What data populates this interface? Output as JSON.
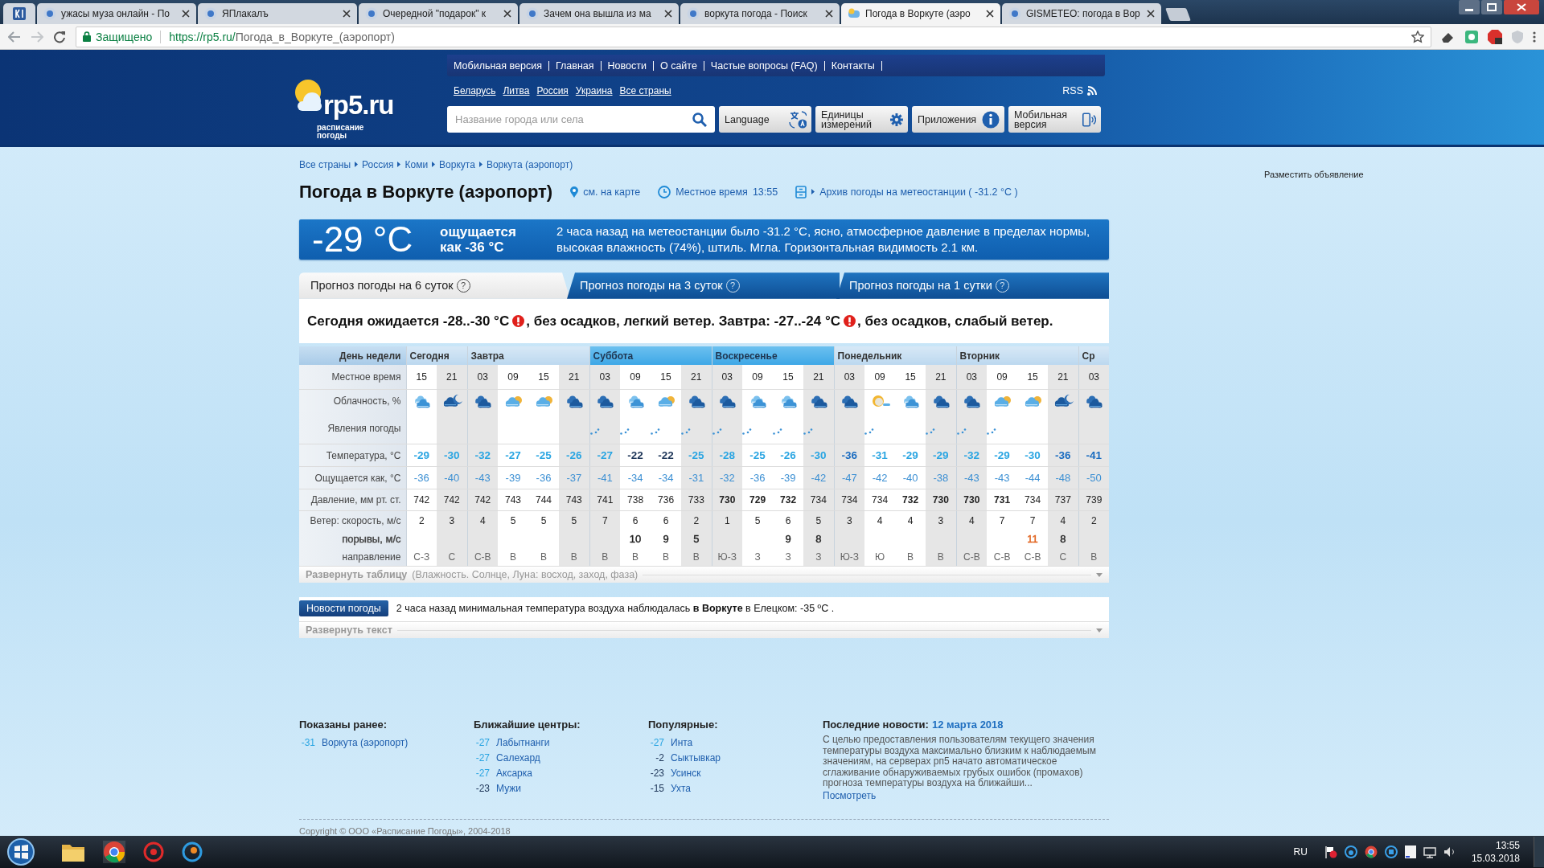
{
  "browser": {
    "tabs": [
      {
        "kind": "pinned",
        "selected": false
      },
      {
        "kind": "page",
        "title": "ужасы муза онлайн - По",
        "selected": false
      },
      {
        "kind": "page",
        "title": "ЯПлакалъ",
        "selected": false
      },
      {
        "kind": "page",
        "title": "Очередной \"подарок\" к",
        "selected": false
      },
      {
        "kind": "page",
        "title": "Зачем она вышла из ма",
        "selected": false
      },
      {
        "kind": "page",
        "title": "воркута погода - Поиск",
        "selected": false
      },
      {
        "kind": "page",
        "title": "Погода в Воркуте (аэро",
        "selected": true
      },
      {
        "kind": "page",
        "title": "GISMETEO: погода в Вор",
        "selected": false
      }
    ],
    "secure": "Защищено",
    "url_host": "https://rp5.ru/",
    "url_path": "Погода_в_Воркуте_(аэропорт)"
  },
  "site": {
    "nav": [
      "Мобильная версия",
      "Главная",
      "Новости",
      "О сайте",
      "Частые вопросы (FAQ)",
      "Контакты"
    ],
    "logo": "rp5.ru",
    "tagline": "расписание погоды",
    "countries": [
      "Беларусь",
      "Литва",
      "Россия",
      "Украина",
      "Все страны"
    ],
    "rss": "RSS",
    "search": {
      "placeholder": "Название города или села"
    },
    "tools": [
      {
        "label": "Language",
        "kind": "translate"
      },
      {
        "label": "Единицы измерений",
        "kind": "gear"
      },
      {
        "label": "Приложения",
        "kind": "info"
      },
      {
        "label": "Мобильная версия",
        "kind": "phone"
      }
    ]
  },
  "breadcrumbs": [
    "Все страны",
    "Россия",
    "Коми",
    "Воркута",
    "Воркута (аэропорт)"
  ],
  "title": "Погода в Воркуте (аэропорт)",
  "map_link": "см. на карте",
  "local_time_label": "Местное время",
  "local_time": "13:55",
  "archive": "Архив погоды на метеостанции ( -31.2 °C )",
  "ad": "Разместить объявление",
  "current": {
    "temp": "-29 °C",
    "feels_label": "ощущается",
    "feels": "как -36 °C",
    "description": "2 часа назад на метеостанции было -31.2 °C, ясно, атмосферное давление в пределах нормы, высокая влажность (74%), штиль. Мгла. Горизонтальная видимость 2.1 км."
  },
  "forecast_tabs": [
    {
      "label": "Прогноз погоды на 6 суток",
      "help": "?",
      "selected": true
    },
    {
      "label": "Прогноз погоды на 3 суток",
      "help": "?",
      "selected": false
    },
    {
      "label": "Прогноз погоды на 1 сутки",
      "help": "?",
      "selected": false
    }
  ],
  "summary": [
    {
      "text": "Сегодня ожидается -28..-30 °C",
      "warning": true
    },
    {
      "text": ", без осадков, легкий ветер. Завтра: -27..-24 °C",
      "warning": true
    },
    {
      "text": ", без осадков, слабый ветер.",
      "warning": false
    }
  ],
  "table": {
    "row_labels": [
      "День недели",
      "Местное время",
      "Облачность, %",
      "Явления погоды",
      "Температура, °C",
      "Ощущается как, °C",
      "Давление, мм рт. ст.",
      "Ветер: скорость, м/с",
      "порывы, м/с",
      "направление"
    ],
    "days": [
      {
        "label": "Сегодня",
        "weekend": false,
        "slots": [
          {
            "time": "15",
            "night": false,
            "kind": "overcast",
            "snow": false,
            "temp": "-29",
            "color": "#2aa5e2",
            "feels": "-36",
            "pressure": "742",
            "pressure_bold": false,
            "wind": "2",
            "dir": "С-З"
          },
          {
            "time": "21",
            "night": true,
            "kind": "partly-night",
            "snow": false,
            "temp": "-30",
            "color": "#2aa5e2",
            "feels": "-40",
            "pressure": "742",
            "pressure_bold": false,
            "wind": "3",
            "dir": "С"
          }
        ]
      },
      {
        "label": "Завтра",
        "weekend": false,
        "slots": [
          {
            "time": "03",
            "night": true,
            "kind": "overcast-night",
            "snow": false,
            "temp": "-32",
            "color": "#2aa5e2",
            "feels": "-43",
            "pressure": "742",
            "pressure_bold": false,
            "wind": "4",
            "dir": "С-В"
          },
          {
            "time": "09",
            "night": false,
            "kind": "partly",
            "snow": false,
            "temp": "-27",
            "color": "#2aa5e2",
            "feels": "-39",
            "pressure": "743",
            "pressure_bold": false,
            "wind": "5",
            "dir": "В"
          },
          {
            "time": "15",
            "night": false,
            "kind": "partly",
            "snow": false,
            "temp": "-25",
            "color": "#2aa5e2",
            "feels": "-36",
            "pressure": "744",
            "pressure_bold": false,
            "wind": "5",
            "dir": "В"
          },
          {
            "time": "21",
            "night": true,
            "kind": "overcast-night",
            "snow": false,
            "temp": "-26",
            "color": "#2aa5e2",
            "feels": "-37",
            "pressure": "743",
            "pressure_bold": false,
            "wind": "5",
            "dir": "В"
          }
        ]
      },
      {
        "label": "Суббота",
        "weekend": true,
        "slots": [
          {
            "time": "03",
            "night": true,
            "kind": "overcast-night",
            "snow": true,
            "temp": "-27",
            "color": "#2aa5e2",
            "feels": "-41",
            "pressure": "741",
            "pressure_bold": false,
            "wind": "7",
            "dir": "В"
          },
          {
            "time": "09",
            "night": false,
            "kind": "overcast",
            "snow": true,
            "temp": "-22",
            "color": "#1d3558",
            "feels": "-34",
            "pressure": "738",
            "pressure_bold": false,
            "wind": "6",
            "gust": {
              "value": "10",
              "color": "#222222"
            },
            "dir": "В"
          },
          {
            "time": "15",
            "night": false,
            "kind": "partly",
            "snow": true,
            "temp": "-22",
            "color": "#1d3558",
            "feels": "-34",
            "pressure": "736",
            "pressure_bold": false,
            "wind": "6",
            "gust": {
              "value": "9",
              "color": "#222222"
            },
            "dir": "В"
          },
          {
            "time": "21",
            "night": true,
            "kind": "overcast-night",
            "snow": true,
            "temp": "-25",
            "color": "#2aa5e2",
            "feels": "-31",
            "pressure": "733",
            "pressure_bold": false,
            "wind": "2",
            "gust": {
              "value": "5",
              "color": "#222222"
            },
            "dir": "В"
          }
        ]
      },
      {
        "label": "Воскресенье",
        "weekend": true,
        "slots": [
          {
            "time": "03",
            "night": true,
            "kind": "overcast-night",
            "snow": true,
            "temp": "-28",
            "color": "#2aa5e2",
            "feels": "-32",
            "pressure": "730",
            "pressure_bold": true,
            "wind": "1",
            "dir": "Ю-З"
          },
          {
            "time": "09",
            "night": false,
            "kind": "overcast",
            "snow": true,
            "temp": "-25",
            "color": "#2aa5e2",
            "feels": "-36",
            "pressure": "729",
            "pressure_bold": true,
            "wind": "5",
            "dir": "З"
          },
          {
            "time": "15",
            "night": false,
            "kind": "overcast",
            "snow": true,
            "temp": "-26",
            "color": "#2aa5e2",
            "feels": "-39",
            "pressure": "732",
            "pressure_bold": true,
            "wind": "6",
            "gust": {
              "value": "9",
              "color": "#222222"
            },
            "dir": "З"
          },
          {
            "time": "21",
            "night": true,
            "kind": "overcast-night",
            "snow": true,
            "temp": "-30",
            "color": "#2aa5e2",
            "feels": "-42",
            "pressure": "734",
            "pressure_bold": false,
            "wind": "5",
            "gust": {
              "value": "8",
              "color": "#222222"
            },
            "dir": "З"
          }
        ]
      },
      {
        "label": "Понедельник",
        "weekend": false,
        "slots": [
          {
            "time": "03",
            "night": true,
            "kind": "overcast-night",
            "snow": false,
            "temp": "-36",
            "color": "#1a6cc0",
            "feels": "-47",
            "pressure": "734",
            "pressure_bold": false,
            "wind": "3",
            "dir": "Ю-З"
          },
          {
            "time": "09",
            "night": false,
            "kind": "clear",
            "snow": true,
            "temp": "-31",
            "color": "#2aa5e2",
            "feels": "-42",
            "pressure": "734",
            "pressure_bold": false,
            "wind": "4",
            "dir": "Ю"
          },
          {
            "time": "15",
            "night": false,
            "kind": "overcast",
            "snow": false,
            "temp": "-29",
            "color": "#2aa5e2",
            "feels": "-40",
            "pressure": "732",
            "pressure_bold": true,
            "wind": "4",
            "dir": "В"
          },
          {
            "time": "21",
            "night": true,
            "kind": "overcast-night",
            "snow": true,
            "temp": "-29",
            "color": "#2aa5e2",
            "feels": "-38",
            "pressure": "730",
            "pressure_bold": true,
            "wind": "3",
            "dir": "В"
          }
        ]
      },
      {
        "label": "Вторник",
        "weekend": false,
        "slots": [
          {
            "time": "03",
            "night": true,
            "kind": "overcast-night",
            "snow": true,
            "temp": "-32",
            "color": "#2aa5e2",
            "feels": "-43",
            "pressure": "730",
            "pressure_bold": true,
            "wind": "4",
            "dir": "С-В"
          },
          {
            "time": "09",
            "night": false,
            "kind": "partly",
            "snow": true,
            "temp": "-29",
            "color": "#2aa5e2",
            "feels": "-43",
            "pressure": "731",
            "pressure_bold": true,
            "wind": "7",
            "dir": "С-В"
          },
          {
            "time": "15",
            "night": false,
            "kind": "partly",
            "snow": false,
            "temp": "-30",
            "color": "#2aa5e2",
            "feels": "-44",
            "pressure": "734",
            "pressure_bold": false,
            "wind": "7",
            "gust": {
              "value": "11",
              "color": "#e0611b"
            },
            "dir": "С-В"
          },
          {
            "time": "21",
            "night": true,
            "kind": "partly-night",
            "snow": false,
            "temp": "-36",
            "color": "#1a6cc0",
            "feels": "-48",
            "pressure": "737",
            "pressure_bold": false,
            "wind": "4",
            "gust": {
              "value": "8",
              "color": "#222222"
            },
            "dir": "С"
          }
        ]
      },
      {
        "label": "Ср",
        "weekend": false,
        "slots": [
          {
            "time": "03",
            "night": true,
            "kind": "overcast-night",
            "snow": false,
            "temp": "-41",
            "color": "#1a6cc0",
            "feels": "-50",
            "pressure": "739",
            "pressure_bold": false,
            "wind": "2",
            "dir": "В"
          }
        ]
      }
    ],
    "expand": "Развернуть таблицу",
    "expand_hint": "(Влажность. Солнце, Луна: восход, заход, фаза)"
  },
  "news": {
    "badge": "Новости погоды",
    "text": "2 часа назад минимальная температура воздуха наблюдалась **в Воркуте** в Елецком: -35 ºC .",
    "expand": "Развернуть текст"
  },
  "footer": {
    "lists": [
      {
        "title": "Показаны ранее:",
        "items": [
          {
            "temp": "-31",
            "color": "#2aa5e2",
            "name": "Воркута (аэропорт)"
          }
        ]
      },
      {
        "title": "Ближайшие центры:",
        "items": [
          {
            "temp": "-27",
            "color": "#2aa5e2",
            "name": "Лабытнанги"
          },
          {
            "temp": "-27",
            "color": "#2aa5e2",
            "name": "Салехард"
          },
          {
            "temp": "-27",
            "color": "#2aa5e2",
            "name": "Аксарка"
          },
          {
            "temp": "-23",
            "color": "#1d3558",
            "name": "Мужи"
          }
        ]
      },
      {
        "title": "Популярные:",
        "items": [
          {
            "temp": "-27",
            "color": "#2aa5e2",
            "name": "Инта"
          },
          {
            "temp": "-2",
            "color": "#1d3558",
            "name": "Сыктывкар"
          },
          {
            "temp": "-23",
            "color": "#1d3558",
            "name": "Усинск"
          },
          {
            "temp": "-15",
            "color": "#1d3558",
            "name": "Ухта"
          }
        ]
      }
    ],
    "news": {
      "title": "Последние новости:",
      "date": "12 марта 2018",
      "text": "С целью предоставления пользователям текущего значения температуры воздуха максимально близким к наблюдаемым значениям, на серверах рп5 начато автоматическое сглаживание обнаруживаемых грубых ошибок (промахов) прогноза температуры воздуха на ближайши...",
      "link": "Посмотреть"
    },
    "copyright": "Copyright © ООО «Расписание Погоды», 2004-2018"
  },
  "taskbar": {
    "lang": "RU",
    "time": "13:55",
    "date": "15.03.2018"
  }
}
